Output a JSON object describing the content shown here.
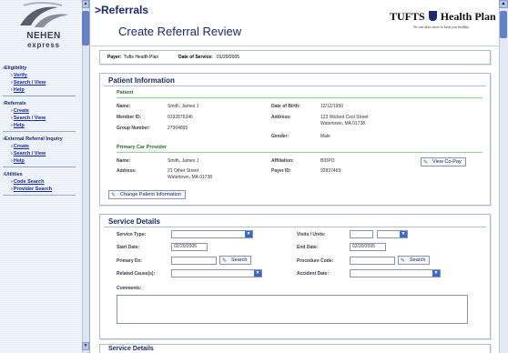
{
  "sidebar": {
    "logo": {
      "line1": "NEHEN",
      "line2": "express"
    },
    "sections": [
      {
        "title": "Eligibility",
        "links": [
          "Verify",
          "Search / View",
          "Help"
        ]
      },
      {
        "title": "Referrals",
        "links": [
          "Create",
          "Search / View",
          "Help"
        ]
      },
      {
        "title": "External Referral Inquiry",
        "links": [
          "Create",
          "Search / View",
          "Help"
        ]
      },
      {
        "title": "Utilities",
        "links": [
          "Code Search",
          "Provider Search"
        ]
      }
    ]
  },
  "header": {
    "breadcrumb": ">Referrals",
    "title": "Create Referral Review",
    "brand": {
      "left": "TUFTS",
      "right": "Health Plan",
      "tagline": "No one does more to keep you healthy."
    }
  },
  "payer_bar": {
    "payer_label": "Payer:",
    "payer_value": "Tufts Health Plan",
    "dos_label": "Date of Service:",
    "dos_value": "01/20/2005"
  },
  "patient_info": {
    "title": "Patient Information",
    "patient": {
      "title": "Patient",
      "name_label": "Name:",
      "name": "Smith, James J",
      "member_label": "Member ID:",
      "member": "0192876346",
      "group_label": "Group Number:",
      "group": "27364895",
      "dob_label": "Date of Birth:",
      "dob": "12/12/1950",
      "address_label": "Address:",
      "address1": "123 Wicked Cool Street",
      "address2": "Watertown, MA 01738",
      "gender_label": "Gender:",
      "gender": "Male"
    },
    "pcp": {
      "title": "Primary Car Provider",
      "name_label": "Name:",
      "name": "Smith, James J",
      "address_label": "Address:",
      "address1": "21 Other Street",
      "address2": "Watertown, MA 01738",
      "affiliation_label": "Affiliation:",
      "affiliation": "BIDPO",
      "payer_id_label": "Payer ID:",
      "payer_id": "92837465",
      "copay_button": "View Co-Pay"
    },
    "change_button": "Change Patient Information"
  },
  "service_details": {
    "title": "Service Details",
    "service_type_label": "Service Type:",
    "visits_label": "Visits / Units:",
    "start_date_label": "Start Date:",
    "start_date": "02/20/2005",
    "end_date_label": "End Date:",
    "end_date": "02/20/2005",
    "primary_dx_label": "Primary Dx:",
    "procedure_code_label": "Procedure Code:",
    "search_button": "Search",
    "related_causes_label": "Related Cause(s):",
    "accident_date_label": "Accident Date:",
    "comments_label": "Comments:"
  },
  "bottom_section": {
    "title": "Service Details"
  },
  "colors": {
    "accent": "#1a2a6a",
    "link": "#1a2aa0",
    "subhead": "#2b6a2b"
  }
}
